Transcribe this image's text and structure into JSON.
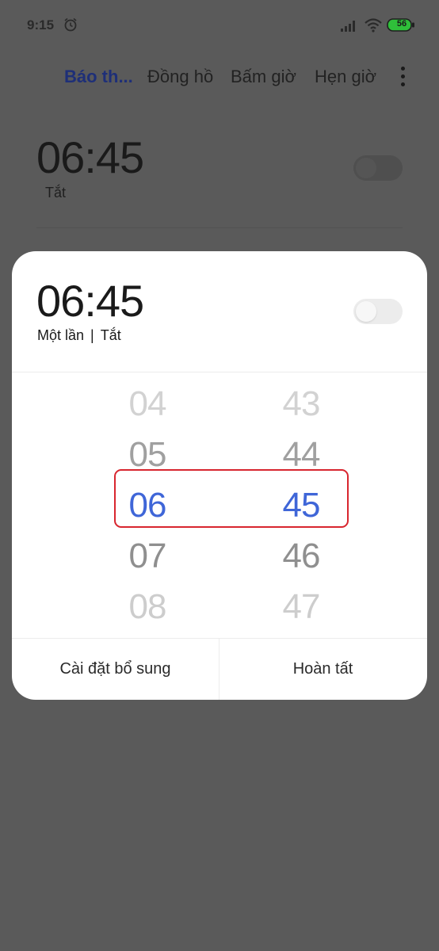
{
  "status_bar": {
    "time": "9:15",
    "battery": "56",
    "icons": [
      "alarm-icon",
      "signal-icon",
      "wifi-icon",
      "battery-icon"
    ]
  },
  "tabs": [
    {
      "label": "Báo th...",
      "active": true
    },
    {
      "label": "Đồng hồ",
      "active": false
    },
    {
      "label": "Bấm giờ",
      "active": false
    },
    {
      "label": "Hẹn giờ",
      "active": false
    }
  ],
  "background_alarm": {
    "time": "06:45",
    "status": "Tắt"
  },
  "dialog": {
    "time": "06:45",
    "repeat": "Một lần",
    "separator": "|",
    "label": "Tắt",
    "toggle_on": false,
    "hour_picker": [
      "04",
      "05",
      "06",
      "07",
      "08"
    ],
    "minute_picker": [
      "43",
      "44",
      "45",
      "46",
      "47"
    ],
    "selected_hour": "06",
    "selected_minute": "45",
    "left_button": "Cài đặt bổ sung",
    "right_button": "Hoàn tất"
  },
  "colors": {
    "accent": "#3f66d8",
    "active_tab": "#1e2f78",
    "highlight": "#d8262f",
    "overlay": "#5a5a5a"
  }
}
